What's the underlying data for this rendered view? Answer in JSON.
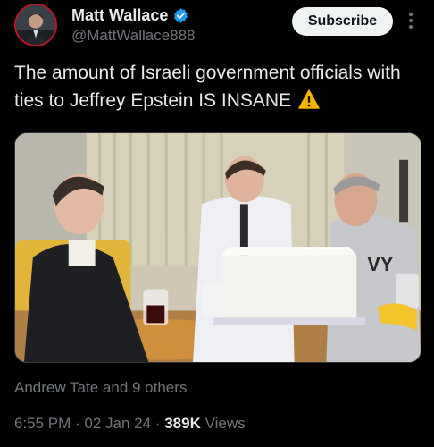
{
  "author": {
    "display_name": "Matt Wallace",
    "handle": "@MattWallace888",
    "verified": true
  },
  "actions": {
    "subscribe_label": "Subscribe"
  },
  "tweet": {
    "text": "The amount of Israeli government officials with ties to Jeffrey Epstein IS INSANE",
    "emoji": "warning-icon"
  },
  "media": {
    "cake_text": "VY"
  },
  "social_context": "Andrew Tate and 9 others",
  "meta": {
    "time": "6:55 PM",
    "date": "02 Jan 24",
    "views_count": "389K",
    "views_label": "Views"
  },
  "colors": {
    "background": "#000000",
    "verified": "#1d9bf0",
    "muted": "#71767b",
    "text": "#e7e9ea"
  }
}
